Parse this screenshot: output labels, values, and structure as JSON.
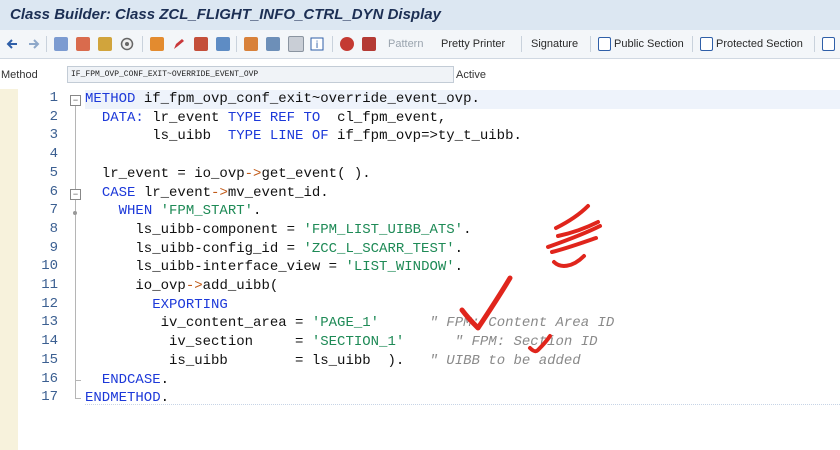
{
  "window": {
    "title": "Class Builder: Class ZCL_FLIGHT_INFO_CTRL_DYN Display"
  },
  "toolbar": {
    "icons": [
      "back-arrow-icon",
      "forward-arrow-icon",
      "other-object-icon",
      "display-change-icon",
      "activate-icon",
      "check-icon",
      "where-used-icon",
      "hierarchy-icon",
      "edit-icon",
      "pattern-insert-icon",
      "navigate-icon",
      "object-list-icon",
      "signature-icon",
      "window-icon",
      "info-icon",
      "help-icon",
      "layout-icon"
    ],
    "pattern_label": "Pattern",
    "pretty_printer_label": "Pretty Printer",
    "signature_label": "Signature",
    "public_section_label": "Public Section",
    "protected_section_label": "Protected Section"
  },
  "method": {
    "label": "Method",
    "value": "IF_FPM_OVP_CONF_EXIT~OVERRIDE_EVENT_OVP",
    "status": "Active"
  },
  "editor": {
    "lines": [
      {
        "no": "1",
        "parts": [
          {
            "c": "kw",
            "t": "METHOD"
          },
          {
            "c": "",
            "t": " if_fpm_ovp_conf_exit~override_event_ovp."
          }
        ]
      },
      {
        "no": "2",
        "parts": [
          {
            "c": "",
            "t": "  "
          },
          {
            "c": "kw",
            "t": "DATA:"
          },
          {
            "c": "",
            "t": " lr_event "
          },
          {
            "c": "kw",
            "t": "TYPE REF TO"
          },
          {
            "c": "",
            "t": "  cl_fpm_event,"
          }
        ]
      },
      {
        "no": "3",
        "parts": [
          {
            "c": "",
            "t": "        ls_uibb  "
          },
          {
            "c": "kw",
            "t": "TYPE LINE OF"
          },
          {
            "c": "",
            "t": " if_fpm_ovp=>ty_t_uibb."
          }
        ]
      },
      {
        "no": "4",
        "parts": []
      },
      {
        "no": "5",
        "parts": [
          {
            "c": "",
            "t": "  lr_event = io_ovp"
          },
          {
            "c": "op",
            "t": "->"
          },
          {
            "c": "",
            "t": "get_event( )."
          }
        ]
      },
      {
        "no": "6",
        "parts": [
          {
            "c": "",
            "t": "  "
          },
          {
            "c": "kw",
            "t": "CASE"
          },
          {
            "c": "",
            "t": " lr_event"
          },
          {
            "c": "op",
            "t": "->"
          },
          {
            "c": "",
            "t": "mv_event_id."
          }
        ]
      },
      {
        "no": "7",
        "parts": [
          {
            "c": "",
            "t": "    "
          },
          {
            "c": "kw",
            "t": "WHEN"
          },
          {
            "c": "",
            "t": " "
          },
          {
            "c": "str",
            "t": "'FPM_START'"
          },
          {
            "c": "",
            "t": "."
          }
        ]
      },
      {
        "no": "8",
        "parts": [
          {
            "c": "",
            "t": "      ls_uibb-component = "
          },
          {
            "c": "str",
            "t": "'FPM_LIST_UIBB_ATS'"
          },
          {
            "c": "",
            "t": "."
          }
        ]
      },
      {
        "no": "9",
        "parts": [
          {
            "c": "",
            "t": "      ls_uibb-config_id = "
          },
          {
            "c": "str",
            "t": "'ZCC_L_SCARR_TEST'"
          },
          {
            "c": "",
            "t": "."
          }
        ]
      },
      {
        "no": "10",
        "parts": [
          {
            "c": "",
            "t": "      ls_uibb-interface_view = "
          },
          {
            "c": "str",
            "t": "'LIST_WINDOW'"
          },
          {
            "c": "",
            "t": "."
          }
        ]
      },
      {
        "no": "11",
        "parts": [
          {
            "c": "",
            "t": "      io_ovp"
          },
          {
            "c": "op",
            "t": "->"
          },
          {
            "c": "",
            "t": "add_uibb("
          }
        ]
      },
      {
        "no": "12",
        "parts": [
          {
            "c": "",
            "t": "        "
          },
          {
            "c": "kw",
            "t": "EXPORTING"
          }
        ]
      },
      {
        "no": "13",
        "parts": [
          {
            "c": "",
            "t": "         iv_content_area = "
          },
          {
            "c": "str",
            "t": "'PAGE_1'"
          },
          {
            "c": "",
            "t": "      "
          },
          {
            "c": "cm",
            "t": "\" FPM: Content Area ID"
          }
        ]
      },
      {
        "no": "14",
        "parts": [
          {
            "c": "",
            "t": "          iv_section     = "
          },
          {
            "c": "str",
            "t": "'SECTION_1'"
          },
          {
            "c": "",
            "t": "      "
          },
          {
            "c": "cm",
            "t": "\" FPM: Section ID"
          }
        ]
      },
      {
        "no": "15",
        "parts": [
          {
            "c": "",
            "t": "          is_uibb        = ls_uibb  )."
          },
          {
            "c": "",
            "t": "   "
          },
          {
            "c": "cm",
            "t": "\" UIBB to be added"
          }
        ]
      },
      {
        "no": "16",
        "parts": [
          {
            "c": "",
            "t": "  "
          },
          {
            "c": "kw",
            "t": "ENDCASE"
          },
          {
            "c": "",
            "t": "."
          }
        ]
      },
      {
        "no": "17",
        "parts": [
          {
            "c": "kw",
            "t": "ENDMETHOD"
          },
          {
            "c": "",
            "t": "."
          }
        ]
      }
    ]
  },
  "annotations": {
    "color": "#e0251c",
    "type": "handwritten-checkmarks"
  }
}
